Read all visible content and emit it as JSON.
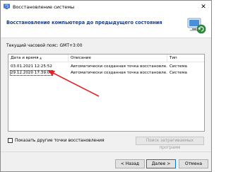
{
  "window": {
    "title": "Восстановление системы",
    "close_glyph": "✕"
  },
  "header": {
    "title": "Восстановление компьютера до предыдущего состояния"
  },
  "timezone": "Текущий часовой пояс: GMT+3:00",
  "table": {
    "columns": [
      "Дата и время",
      "Описание",
      "Тип"
    ],
    "rows": [
      {
        "date": "03.01.2021 12:25:52",
        "description": "Автоматически созданная точка восстановле...",
        "type": "Система"
      },
      {
        "date": "29.12.2020 17:39:08",
        "description": "Автоматически созданная точка восстановле...",
        "type": "Система"
      }
    ]
  },
  "show_more": {
    "label": "Показать другие точки восстановления",
    "checked": false
  },
  "scan_button": "Поиск затрагиваемых программ",
  "buttons": {
    "back": "< Назад",
    "next": "Далее >",
    "cancel": "Отмена"
  },
  "colors": {
    "header_title": "#1a3e8c",
    "arrow": "#e0242a",
    "accent": "#0078d7"
  }
}
